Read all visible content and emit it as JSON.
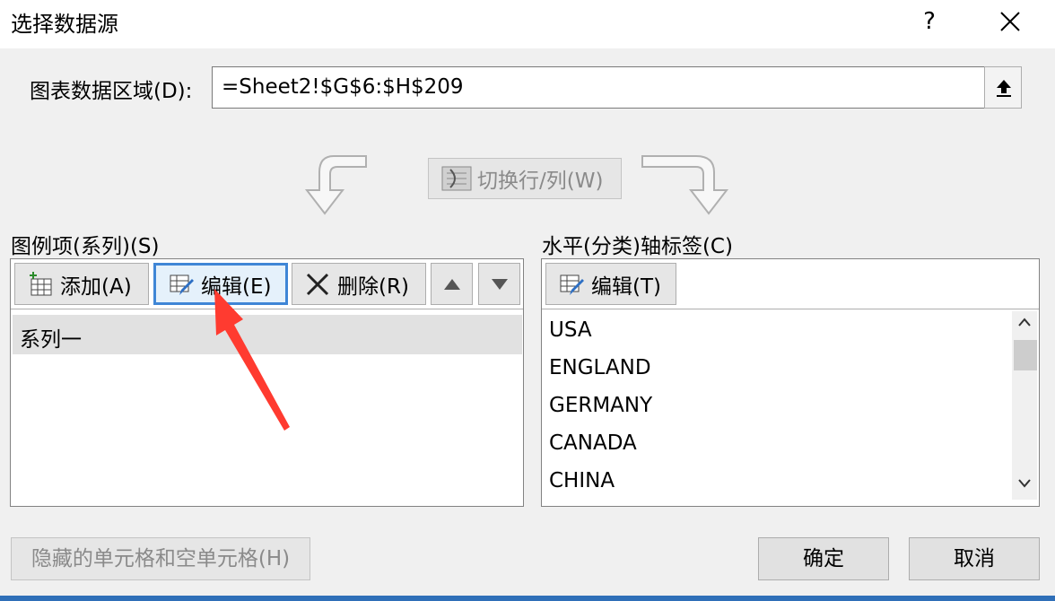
{
  "window": {
    "title": "选择数据源",
    "help": "?"
  },
  "range": {
    "label": "图表数据区域(D):",
    "value": "=Sheet2!$G$6:$H$209"
  },
  "switch_button": {
    "label": "切换行/列(W)"
  },
  "legend": {
    "label": "图例项(系列)(S)",
    "add": "添加(A)",
    "edit": "编辑(E)",
    "delete": "删除(R)",
    "items": [
      "系列一"
    ]
  },
  "axis": {
    "label": "水平(分类)轴标签(C)",
    "edit": "编辑(T)",
    "items": [
      "USA",
      "ENGLAND",
      "GERMANY",
      "CANADA",
      "CHINA"
    ]
  },
  "footer": {
    "hidden_cells": "隐藏的单元格和空单元格(H)",
    "ok": "确定",
    "cancel": "取消"
  },
  "colors": {
    "accent": "#3f86d6",
    "annotation": "#ff3b30",
    "titlebar_bottom": "#2f6fb8"
  }
}
